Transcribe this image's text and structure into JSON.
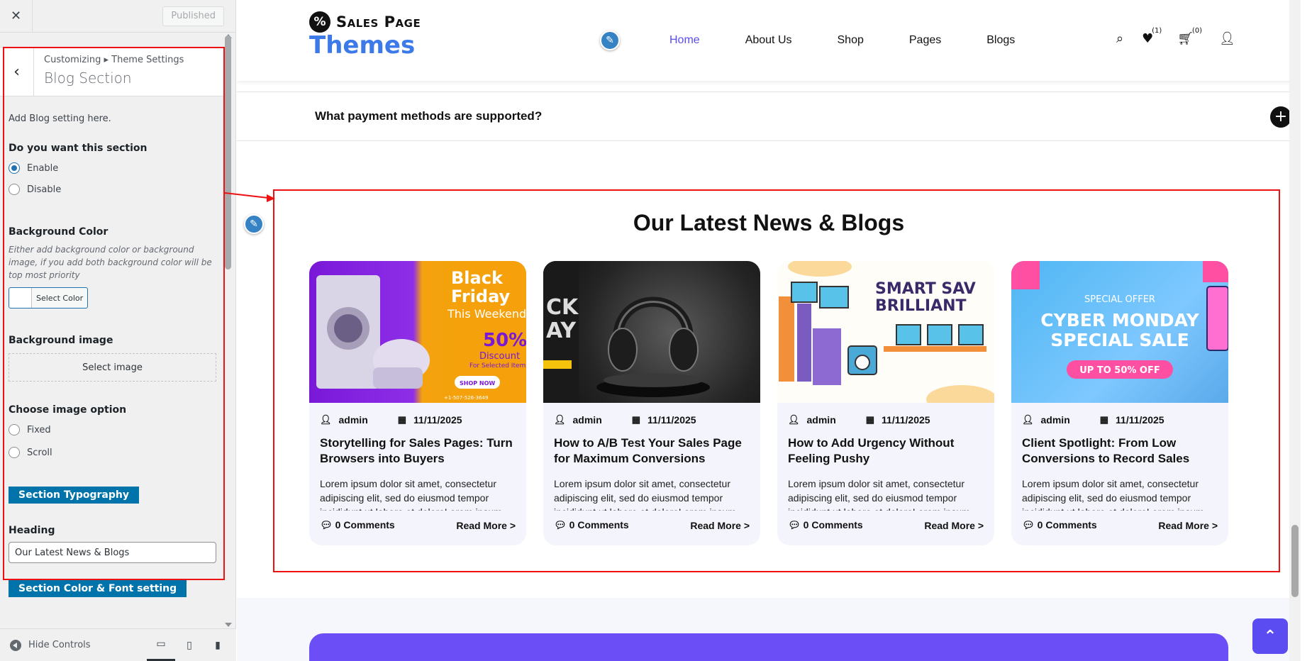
{
  "sidebar": {
    "published_label": "Published",
    "breadcrumb": "Customizing ▸ Theme Settings",
    "section_title": "Blog Section",
    "description": "Add Blog setting here.",
    "show_section_label": "Do you want this section",
    "enable_label": "Enable",
    "disable_label": "Disable",
    "show_section_value": "Enable",
    "bg_color_label": "Background Color",
    "bg_color_note": "Either add background color or background image, if you add both background color will be top most priority",
    "select_color_label": "Select Color",
    "bg_image_label": "Background image",
    "select_image_label": "Select image",
    "image_option_label": "Choose image option",
    "fixed_label": "Fixed",
    "scroll_label": "Scroll",
    "typography_button": "Section Typography",
    "heading_label": "Heading",
    "heading_value": "Our Latest News & Blogs",
    "color_font_button": "Section Color & Font setting",
    "hide_controls_label": "Hide Controls"
  },
  "site": {
    "logo_name": "Sales Page",
    "logo_sub": "Themes",
    "nav": [
      "Home",
      "About Us",
      "Shop",
      "Pages",
      "Blogs"
    ],
    "active_nav": "Home",
    "wishlist_count": "(1)",
    "cart_count": "(0)",
    "faq_question": "What payment methods are supported?",
    "blogs_heading": "Our Latest News & Blogs",
    "cards": [
      {
        "author": "admin",
        "date": "11/11/2025",
        "title": "Storytelling for Sales Pages: Turn Browsers into Buyers",
        "excerpt": "Lorem ipsum dolor sit amet, consectetur adipiscing elit, sed do eiusmod tempor incididunt ut labore et doloreLorem ipsum",
        "comments": "0 Comments",
        "read_more": "Read More >"
      },
      {
        "author": "admin",
        "date": "11/11/2025",
        "title": "How to A/B Test Your Sales Page for Maximum Conversions",
        "excerpt": "Lorem ipsum dolor sit amet, consectetur adipiscing elit, sed do eiusmod tempor incididunt ut labore et doloreLorem ipsum",
        "comments": "0 Comments",
        "read_more": "Read More >"
      },
      {
        "author": "admin",
        "date": "11/11/2025",
        "title": "How to Add Urgency Without Feeling Pushy",
        "excerpt": "Lorem ipsum dolor sit amet, consectetur adipiscing elit, sed do eiusmod tempor incididunt ut labore et doloreLorem ipsum",
        "comments": "0 Comments",
        "read_more": "Read More >"
      },
      {
        "author": "admin",
        "date": "11/11/2025",
        "title": "Client Spotlight: From Low Conversions to Record Sales",
        "excerpt": "Lorem ipsum dolor sit amet, consectetur adipiscing elit, sed do eiusmod tempor incididunt ut labore et doloreLorem ipsum",
        "comments": "0 Comments",
        "read_more": "Read More >"
      }
    ],
    "card_images": {
      "c1": {
        "line1": "Black",
        "line2": "Friday",
        "line3": "This Weekend",
        "pct": "50%",
        "disc": "Discount",
        "sub": "For Selected Items",
        "cta": "SHOP NOW",
        "phone": "+1-507-526-3649"
      },
      "c2": {
        "side": "CK\nAY"
      },
      "c3": {
        "line1": "SMART SAV",
        "line2": "BRILLIANT"
      },
      "c4": {
        "kicker": "SPECIAL OFFER",
        "line1": "CYBER MONDAY",
        "line2": "SPECIAL SALE",
        "cta": "UP TO 50% OFF"
      }
    }
  },
  "colors": {
    "accent": "#5b4cf2",
    "logo_blue": "#3b7ae8",
    "wp_blue": "#0073aa",
    "annotation_red": "#ee1111"
  }
}
